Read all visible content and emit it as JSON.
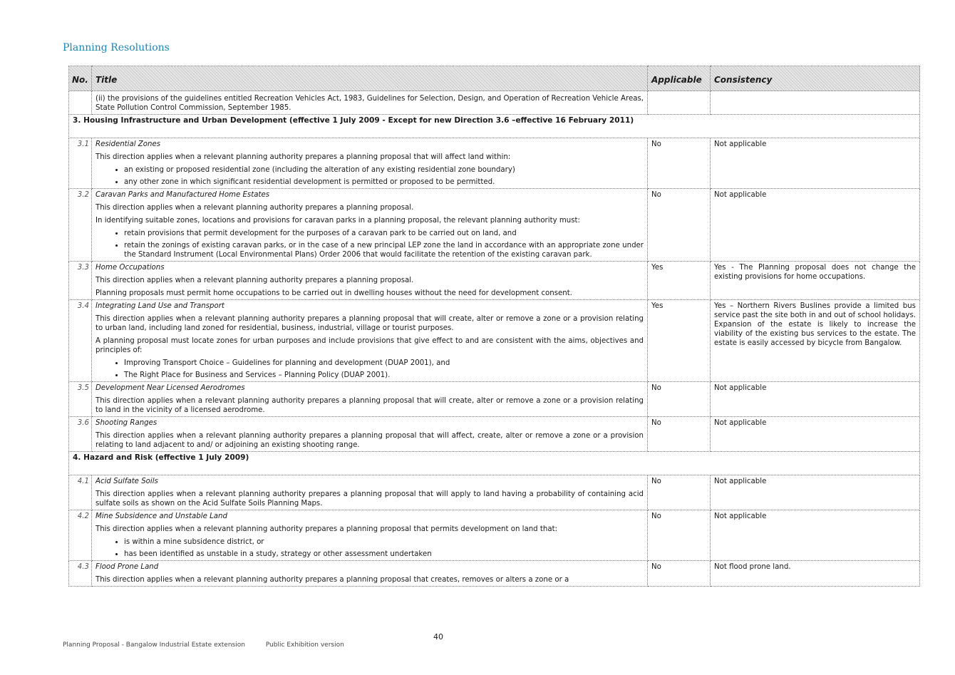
{
  "heading": "Planning Resolutions",
  "columns": {
    "no": "No.",
    "title": "Title",
    "applicable": "Applicable",
    "consistency": "Consistency"
  },
  "rows": {
    "cont": {
      "text": "(ii) the provisions of the guidelines entitled Recreation Vehicles Act, 1983, Guidelines for Selection, Design, and Operation of Recreation Vehicle Areas, State Pollution Control Commission, September 1985."
    },
    "sec3": "3. Housing Infrastructure and Urban Development (effective 1 July 2009 - Except for new Direction 3.6 –effective 16 February 2011)",
    "r31": {
      "no": "3.1",
      "title": "Residential Zones",
      "p1": "This direction applies when a relevant planning authority prepares a planning proposal that will affect land within:",
      "b1": "an existing or proposed residential zone (including the alteration of any existing residential zone boundary)",
      "b2": "any other zone in which significant residential development is permitted or proposed to be permitted.",
      "applicable": "No",
      "consistency": "Not applicable"
    },
    "r32": {
      "no": "3.2",
      "title": "Caravan Parks and Manufactured Home Estates",
      "p1": "This direction applies when a relevant planning authority prepares a planning proposal.",
      "p2": "In identifying suitable zones, locations and provisions for caravan parks in a planning proposal, the relevant planning authority must:",
      "b1": "retain provisions that permit development for the purposes of a caravan park to be carried out on land, and",
      "b2": "retain the zonings of existing caravan parks, or in the case of a new principal LEP zone the land in accordance with an appropriate zone under the Standard Instrument (Local Environmental Plans) Order 2006 that would facilitate the retention of the existing caravan park.",
      "applicable": "No",
      "consistency": "Not applicable"
    },
    "r33": {
      "no": "3.3",
      "title": "Home Occupations",
      "p1": "This direction applies when a relevant planning authority prepares a planning proposal.",
      "p2": "Planning proposals must permit home occupations to be carried out in dwelling houses without the need for development consent.",
      "applicable": "Yes",
      "consistency": "Yes - The Planning proposal does not change the existing provisions for home occupations."
    },
    "r34": {
      "no": "3.4",
      "title": "Integrating Land Use and Transport",
      "p1": "This direction applies when a relevant planning authority prepares a planning proposal that will create, alter or remove a zone or a provision relating to urban land, including land zoned for residential, business, industrial, village or tourist purposes.",
      "p2": "A planning proposal must locate zones for urban purposes and include provisions that give effect to and are consistent with the aims, objectives and principles of:",
      "b1": "Improving Transport Choice – Guidelines for planning and development (DUAP 2001), and",
      "b2": "The Right Place for Business and Services – Planning Policy (DUAP 2001).",
      "applicable": "Yes",
      "consistency": "Yes – Northern Rivers Buslines provide a limited bus service past the site both in and out of school holidays.  Expansion of the estate is likely to increase the viability of the existing bus services to the estate.   The estate is easily accessed by bicycle from Bangalow."
    },
    "r35": {
      "no": "3.5",
      "title": "Development Near Licensed Aerodromes",
      "p1": "This direction applies when a relevant planning authority prepares a planning proposal that will create, alter or remove a zone or a provision relating to land in the vicinity of a licensed aerodrome.",
      "applicable": "No",
      "consistency": "Not applicable"
    },
    "r36": {
      "no": "3.6",
      "title": "Shooting Ranges",
      "p1": "This direction applies when a relevant planning authority prepares a planning proposal that will affect, create, alter or remove a zone or a provision relating to land adjacent to and/ or adjoining an existing shooting range.",
      "applicable": "No",
      "consistency": "Not applicable"
    },
    "sec4": "4. Hazard and Risk (effective 1 July 2009)",
    "r41": {
      "no": "4.1",
      "title": "Acid Sulfate Soils",
      "p1": "This direction applies when a relevant planning authority prepares a planning proposal that will apply to land having a probability of containing acid sulfate soils as shown on the Acid Sulfate Soils Planning Maps.",
      "applicable": "No",
      "consistency": "Not applicable"
    },
    "r42": {
      "no": "4.2",
      "title": "Mine Subsidence and Unstable Land",
      "p1": "This direction applies when a relevant planning authority prepares a planning proposal that permits development on land that:",
      "b1": "is within a mine subsidence district, or",
      "b2": "has been identified as unstable in a study, strategy or other assessment undertaken",
      "applicable": "No",
      "consistency": "Not applicable"
    },
    "r43": {
      "no": "4.3",
      "title": "Flood Prone Land",
      "p1": "This direction applies when a relevant planning authority prepares a planning proposal that creates, removes or alters a zone or a",
      "applicable": "No",
      "consistency": "Not flood prone land."
    }
  },
  "page_number": "40",
  "footer": {
    "doc": "Planning Proposal - Bangalow Industrial Estate extension",
    "version": "Public Exhibition version"
  }
}
